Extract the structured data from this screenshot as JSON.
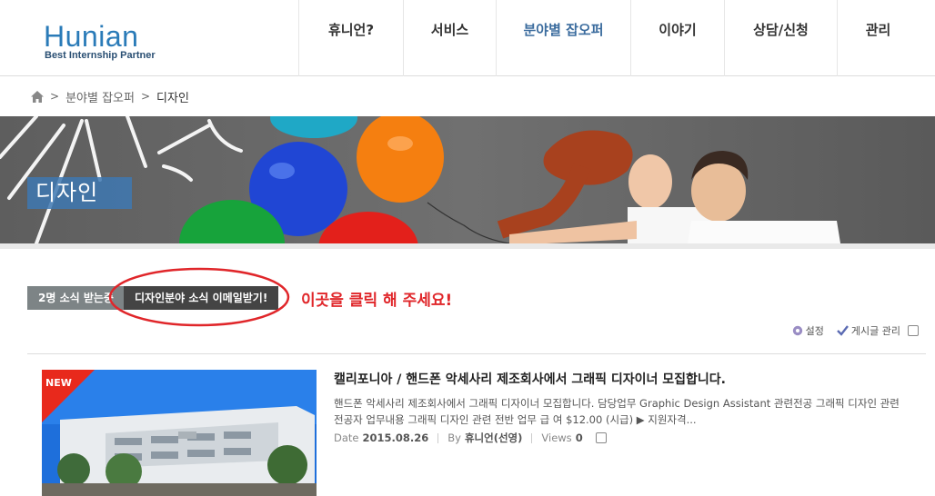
{
  "logo": {
    "main": "Hunian",
    "sub": "Best Internship Partner"
  },
  "nav": [
    {
      "label": "휴니언?",
      "active": false
    },
    {
      "label": "서비스",
      "active": false
    },
    {
      "label": "분야별 잡오퍼",
      "active": true
    },
    {
      "label": "이야기",
      "active": false
    },
    {
      "label": "상담/신청",
      "active": false
    },
    {
      "label": "관리",
      "active": false
    }
  ],
  "breadcrumb": {
    "home_icon": "home-icon",
    "items": [
      "분야별 잡오퍼",
      "디자인"
    ]
  },
  "banner": {
    "title": "디자인"
  },
  "subscribe": {
    "count_label": "2명 소식 받는중",
    "button_label": "디자인분야 소식 이메일받기!",
    "hint": "이곳을 클릭 해 주세요!"
  },
  "tools": {
    "settings_label": "설정",
    "manage_label": "게시글 관리"
  },
  "post": {
    "badge": "NEW",
    "title": "캘리포니아 / 핸드폰 악세사리 제조회사에서 그래픽 디자이너 모집합니다.",
    "excerpt": "핸드폰 악세사리 제조회사에서 그래픽 디자이너 모집합니다. 담당업무 Graphic Design Assistant 관련전공 그래픽 디자인 관련 전공자 업무내용 그래픽 디자인 관련 전반 업무 급 여 $12.00 (시급) ▶ 지원자격...",
    "date_label": "Date",
    "date": "2015.08.26",
    "by_label": "By",
    "author": "휴니언(선영)",
    "views_label": "Views",
    "views": "0"
  },
  "colors": {
    "brand": "#2a7bb8",
    "accent_red": "#e0262a",
    "nav_active": "#3b6c9e"
  }
}
